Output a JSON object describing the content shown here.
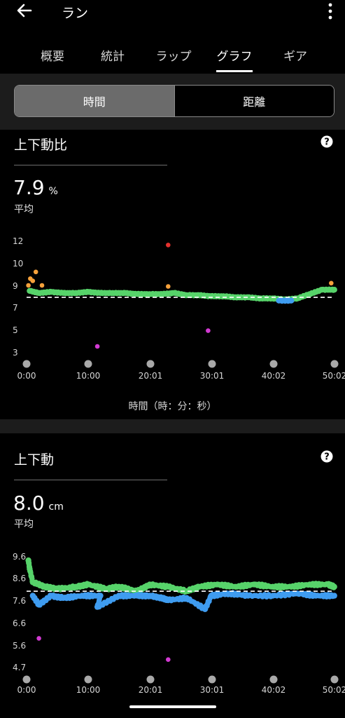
{
  "header": {
    "title": "ラン",
    "back_icon": "arrow-left-icon",
    "menu_icon": "more-vertical-icon"
  },
  "tabs": [
    {
      "label": "概要",
      "active": false
    },
    {
      "label": "統計",
      "active": false
    },
    {
      "label": "ラップ",
      "active": false
    },
    {
      "label": "グラフ",
      "active": true
    },
    {
      "label": "ギア",
      "active": false
    }
  ],
  "segment": {
    "time_label": "時間",
    "distance_label": "距離",
    "selected": "time"
  },
  "colors": {
    "green": "#57d36a",
    "orange": "#f6a13b",
    "blue": "#3f9cf0",
    "red": "#e5312e",
    "magenta": "#d23ad2",
    "axis_dot": "#a9a9a9"
  },
  "section1": {
    "title": "上下動比",
    "value": "7.9",
    "unit": "%",
    "avg_label": "平均",
    "help_icon": "help-circle-icon",
    "x_axis_title": "時間（時：分：秒）"
  },
  "section2": {
    "title": "上下動",
    "value": "8.0",
    "unit": "cm",
    "avg_label": "平均",
    "help_icon": "help-circle-icon"
  },
  "chart_data": [
    {
      "type": "scatter",
      "title": "上下動比",
      "xlabel": "時間（時：分：秒）",
      "ylabel": "",
      "x_ticks": [
        "0:00",
        "10:00",
        "20:01",
        "30:01",
        "40:02",
        "50:02"
      ],
      "y_ticks": [
        "12",
        "10",
        "9",
        "7",
        "5",
        "3"
      ],
      "ylim": [
        3,
        12
      ],
      "average_line": 7.9,
      "series": [
        {
          "color": "green",
          "points": [
            [
              0.5,
              8.5
            ],
            [
              2,
              8.3
            ],
            [
              4,
              8.4
            ],
            [
              6,
              8.3
            ],
            [
              8,
              8.3
            ],
            [
              10,
              8.4
            ],
            [
              12,
              8.3
            ],
            [
              14,
              8.3
            ],
            [
              16,
              8.3
            ],
            [
              18,
              8.2
            ],
            [
              20,
              8.2
            ],
            [
              22,
              8.2
            ],
            [
              24,
              8.3
            ],
            [
              26,
              8.1
            ],
            [
              28,
              8.1
            ],
            [
              30,
              8.0
            ],
            [
              32,
              8.0
            ],
            [
              34,
              7.9
            ],
            [
              36,
              7.9
            ],
            [
              38,
              7.8
            ],
            [
              40,
              7.8
            ],
            [
              42,
              7.7
            ],
            [
              44,
              7.8
            ],
            [
              46,
              8.2
            ],
            [
              48,
              8.6
            ],
            [
              50,
              8.6
            ]
          ]
        },
        {
          "color": "orange",
          "points": [
            [
              0.3,
              9.0
            ],
            [
              0.6,
              9.3
            ],
            [
              1,
              9.2
            ],
            [
              1.5,
              9.6
            ],
            [
              2.5,
              9.0
            ],
            [
              23,
              8.9
            ],
            [
              49.5,
              9.1
            ]
          ]
        },
        {
          "color": "blue",
          "points": [
            [
              41,
              7.6
            ],
            [
              43,
              7.6
            ]
          ]
        },
        {
          "color": "red",
          "points": [
            [
              23,
              11.6
            ]
          ]
        },
        {
          "color": "magenta",
          "points": [
            [
              11.5,
              3.5
            ],
            [
              29.5,
              4.9
            ]
          ]
        }
      ]
    },
    {
      "type": "scatter",
      "title": "上下動",
      "xlabel": "",
      "ylabel": "",
      "x_ticks": [
        "0:00",
        "10:00",
        "20:01",
        "30:01",
        "40:02",
        "50:02"
      ],
      "y_ticks": [
        "9.6",
        "8.6",
        "7.6",
        "6.6",
        "5.6",
        "4.7"
      ],
      "ylim": [
        4.7,
        9.6
      ],
      "average_line": 8.0,
      "series": [
        {
          "color": "green",
          "points": [
            [
              0.3,
              9.4
            ],
            [
              0.5,
              9.0
            ],
            [
              1,
              8.4
            ],
            [
              3,
              8.2
            ],
            [
              5,
              8.1
            ],
            [
              8,
              8.2
            ],
            [
              10,
              8.3
            ],
            [
              13,
              8.1
            ],
            [
              15,
              8.2
            ],
            [
              18,
              8.0
            ],
            [
              20,
              8.3
            ],
            [
              23,
              8.2
            ],
            [
              26,
              8.0
            ],
            [
              28,
              8.2
            ],
            [
              31,
              8.3
            ],
            [
              34,
              8.2
            ],
            [
              37,
              8.3
            ],
            [
              40,
              8.2
            ],
            [
              43,
              8.2
            ],
            [
              46,
              8.3
            ],
            [
              49,
              8.3
            ],
            [
              50,
              8.2
            ]
          ]
        },
        {
          "color": "blue",
          "points": [
            [
              1,
              7.8
            ],
            [
              2,
              7.4
            ],
            [
              4,
              7.8
            ],
            [
              6,
              7.7
            ],
            [
              9,
              7.8
            ],
            [
              12,
              7.8
            ],
            [
              11.5,
              7.3
            ],
            [
              15,
              7.8
            ],
            [
              18,
              7.8
            ],
            [
              20,
              7.8
            ],
            [
              22,
              7.7
            ],
            [
              23,
              7.6
            ],
            [
              26,
              7.7
            ],
            [
              29,
              7.2
            ],
            [
              30,
              7.8
            ],
            [
              33,
              7.9
            ],
            [
              36,
              7.8
            ],
            [
              40,
              7.8
            ],
            [
              44,
              7.9
            ],
            [
              47,
              7.8
            ],
            [
              50,
              7.8
            ]
          ]
        },
        {
          "color": "magenta",
          "points": [
            [
              2,
              5.9
            ],
            [
              23,
              5.0
            ]
          ]
        }
      ]
    }
  ]
}
